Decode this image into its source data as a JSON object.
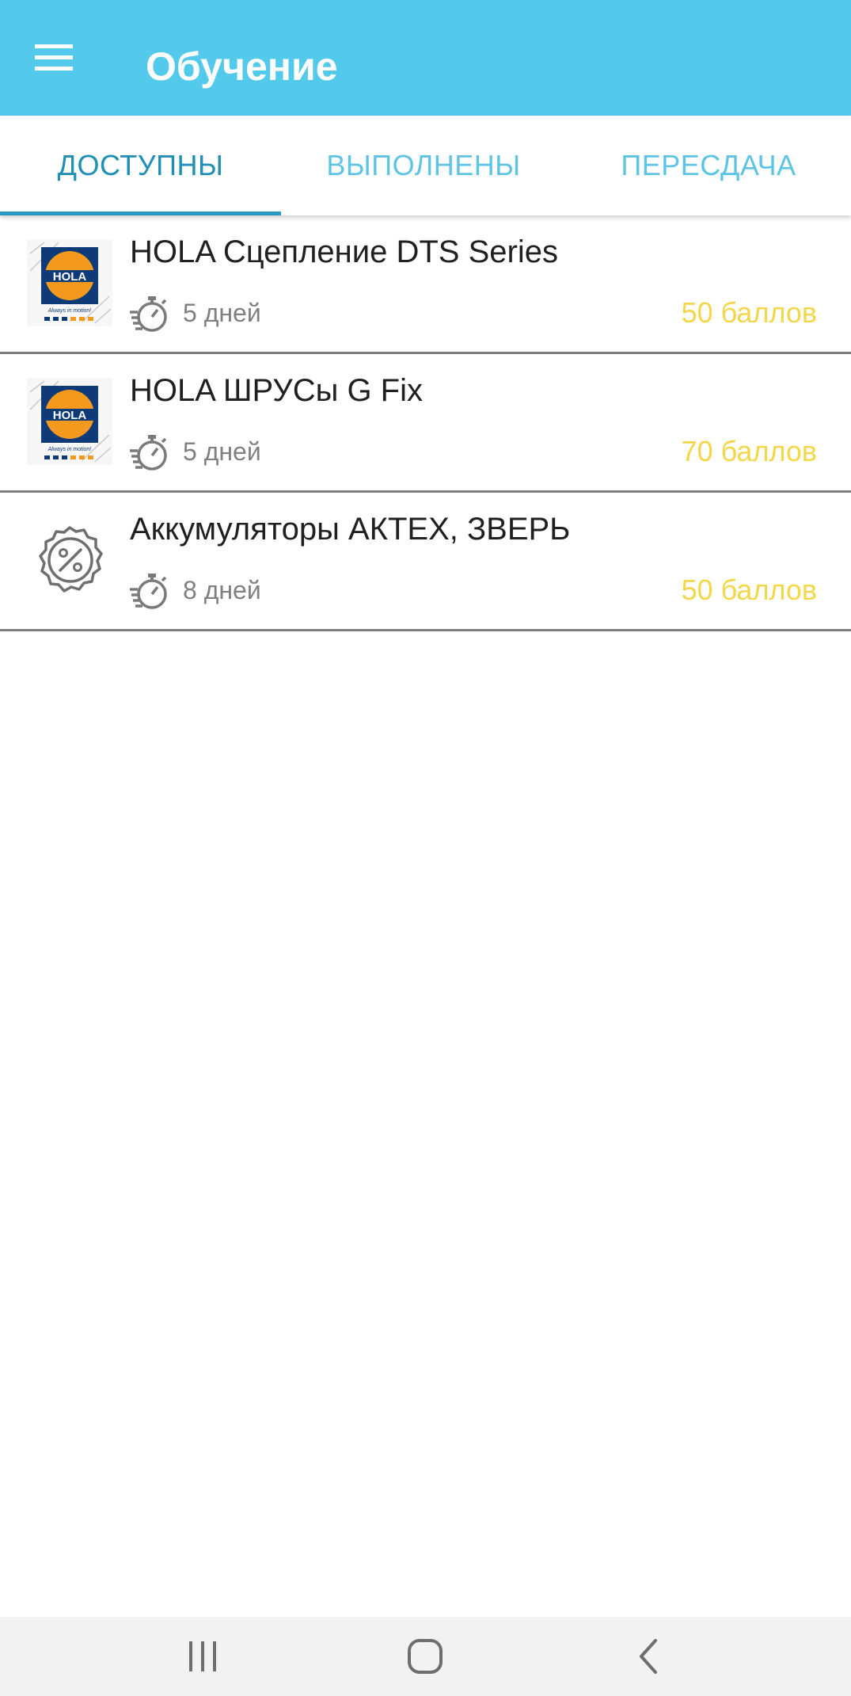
{
  "appbar": {
    "title": "Обучение",
    "menu_icon": "hamburger-menu-icon",
    "background": "#53c9ec"
  },
  "tabs": [
    {
      "label": "ДОСТУПНЫ",
      "active": true
    },
    {
      "label": "ВЫПОЛНЕНЫ",
      "active": false
    },
    {
      "label": "ПЕРЕСДАЧА",
      "active": false
    }
  ],
  "courses": [
    {
      "title": "HOLA Сцепление DTS Series",
      "duration": "5 дней",
      "points": "50 баллов",
      "thumbnail": "hola-logo",
      "thumbnail_text": "HOLA",
      "thumbnail_tagline": "Always in motion!"
    },
    {
      "title": "HOLA ШРУСы G Fix",
      "duration": "5 дней",
      "points": "70 баллов",
      "thumbnail": "hola-logo",
      "thumbnail_text": "HOLA",
      "thumbnail_tagline": "Always in motion!"
    },
    {
      "title": "Аккумуляторы АКТЕХ, ЗВЕРЬ",
      "duration": "8 дней",
      "points": "50 баллов",
      "thumbnail": "discount-badge-icon"
    }
  ],
  "colors": {
    "accent": "#53c9ec",
    "tab_active": "#1f8fb5",
    "tab_inactive": "#5ec4e6",
    "points": "#f3d64a",
    "hola_blue": "#0e3a78",
    "hola_orange": "#f39a1e"
  },
  "system_nav": {
    "recents_icon": "recents-icon",
    "home_icon": "home-icon",
    "back_icon": "back-icon"
  }
}
